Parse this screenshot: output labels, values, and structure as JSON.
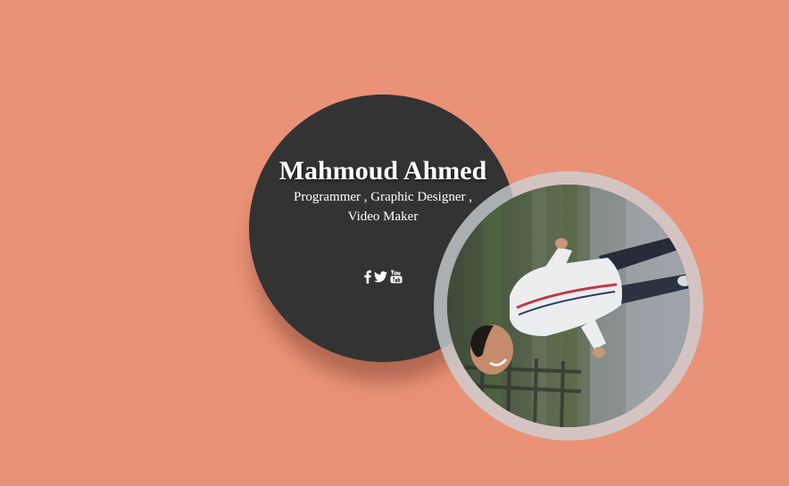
{
  "profile": {
    "name": "Mahmoud Ahmed",
    "role": "Programmer , Graphic Designer , Video Maker"
  },
  "social": {
    "items": [
      {
        "icon": "facebook-icon"
      },
      {
        "icon": "twitter-icon"
      },
      {
        "icon": "youtube-icon"
      }
    ]
  },
  "photo": {
    "icon": "profile-photo"
  },
  "colors": {
    "background": "#ea9277",
    "card": "#333333",
    "photo_ring": "#cdd2d6",
    "text": "#ffffff"
  }
}
